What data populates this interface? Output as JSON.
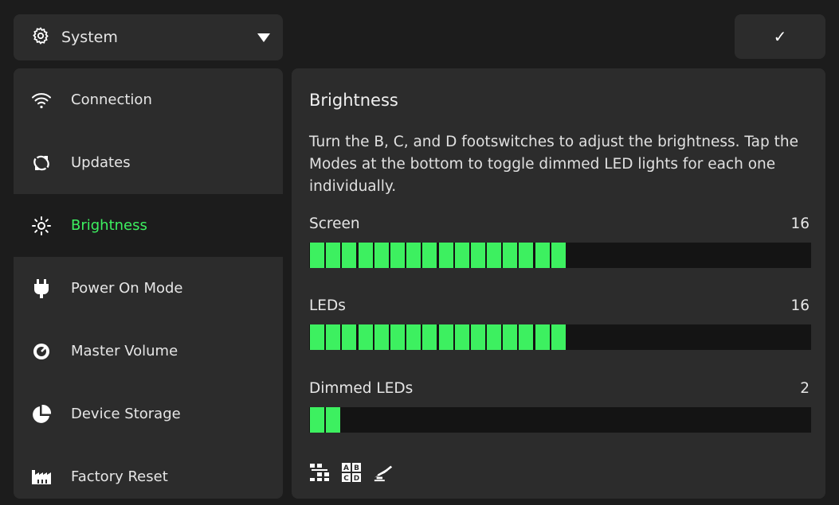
{
  "header": {
    "category_select": {
      "label": "System",
      "icon": "gear-icon"
    },
    "confirm_label": "✓"
  },
  "sidebar": {
    "items": [
      {
        "label": "Connection",
        "icon": "wifi-icon",
        "active": false
      },
      {
        "label": "Updates",
        "icon": "refresh-icon",
        "active": false
      },
      {
        "label": "Brightness",
        "icon": "brightness-icon",
        "active": true
      },
      {
        "label": "Power On Mode",
        "icon": "plug-icon",
        "active": false
      },
      {
        "label": "Master Volume",
        "icon": "volume-knob-icon",
        "active": false
      },
      {
        "label": "Device Storage",
        "icon": "pie-chart-icon",
        "active": false
      },
      {
        "label": "Factory Reset",
        "icon": "factory-icon",
        "active": false
      }
    ]
  },
  "panel": {
    "title": "Brightness",
    "description": "Turn the B, C, and D footswitches to adjust the brightness. Tap the Modes at the bottom to toggle dimmed LED lights for each one individually.",
    "sliders": [
      {
        "label": "Screen",
        "value": "16",
        "level": 16,
        "max": 31
      },
      {
        "label": "LEDs",
        "value": "16",
        "level": 16,
        "max": 31
      },
      {
        "label": "Dimmed LEDs",
        "value": "2",
        "level": 2,
        "max": 31
      }
    ],
    "modes": [
      {
        "icon": "stomp-mode-icon"
      },
      {
        "icon": "abcd-mode-icon"
      },
      {
        "icon": "preset-mode-icon"
      }
    ]
  },
  "colors": {
    "accent": "#3df060",
    "panel": "#2c2c2c",
    "background": "#1c1c1c",
    "track": "#141414"
  }
}
